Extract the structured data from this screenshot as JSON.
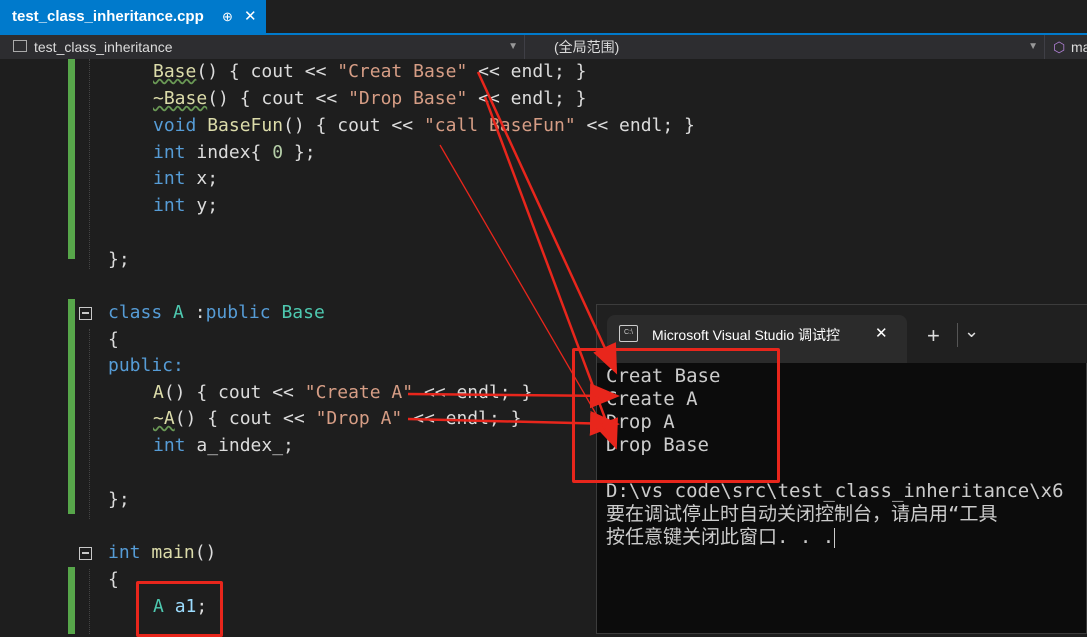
{
  "tab": {
    "title": "test_class_inheritance.cpp",
    "pin": "⊕",
    "close": "✕"
  },
  "navbar": {
    "project": "test_class_inheritance",
    "scope": "(全局范围)",
    "member": "ma"
  },
  "code": {
    "base_ctor": {
      "name": "Base",
      "rest": "() { cout << ",
      "str": "\"Creat Base\"",
      "tail": " << endl; }"
    },
    "base_dtor": {
      "name": "~Base",
      "rest": "() { cout << ",
      "str": "\"Drop Base\"",
      "tail": " << endl; }"
    },
    "basefun": {
      "kw": "void",
      "name": "BaseFun",
      "rest": "() { cout << ",
      "str": "\"call BaseFun\"",
      "tail": " << endl; }"
    },
    "index": {
      "kw": "int",
      "rest": " index{ ",
      "num": "0",
      "tail": " };"
    },
    "x": {
      "kw": "int",
      "rest": " x;"
    },
    "y": {
      "kw": "int",
      "rest": " y;"
    },
    "close1": "};",
    "classA": {
      "kw": "class",
      "name": "A",
      "mid": " :",
      "kw2": "public",
      "base": "Base"
    },
    "brace_open": "{",
    "public": "public:",
    "a_ctor": {
      "name": "A",
      "rest": "() { cout << ",
      "str": "\"Create A\"",
      "tail": " << endl; }"
    },
    "a_dtor": {
      "name": "~A",
      "rest": "() { cout << ",
      "str": "\"Drop A\"",
      "tail": " << endl; }"
    },
    "a_index": {
      "kw": "int",
      "rest": " a_index_;"
    },
    "close2": "};",
    "main": {
      "kw": "int",
      "name": "main",
      "rest": "()"
    },
    "brace_open2": "{",
    "a1": {
      "ty": "A",
      "name": "a1",
      "tail": ";"
    }
  },
  "console": {
    "title": "Microsoft Visual Studio 调试控",
    "close": "✕",
    "add": "+",
    "dropdown": "⌄",
    "lines": [
      "Creat Base",
      "Create A",
      "Drop A",
      "Drop Base"
    ],
    "path": "D:\\vs code\\src\\test_class_inheritance\\x6",
    "msg1": "要在调试停止时自动关闭控制台，请启用“工具",
    "msg2": "按任意键关闭此窗口. . ."
  },
  "colors": {
    "accent": "#007acc",
    "annotation": "#e8261c",
    "gutter": "#57a64a"
  }
}
